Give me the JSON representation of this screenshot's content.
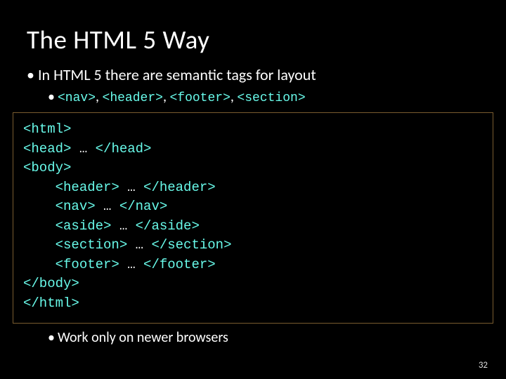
{
  "title": "The HTML 5 Way",
  "bullet1": "In HTML 5 there are semantic tags for layout",
  "tags_line": {
    "t1": "<nav>",
    "t2": "<header>",
    "t3": "<footer>",
    "t4": "<section>"
  },
  "code": {
    "l1": "<html>",
    "l2a": "<head>",
    "l2b": " … ",
    "l2c": "</head>",
    "l3": "<body>",
    "l4a": "    <header>",
    "l4b": " … ",
    "l4c": "</header>",
    "l5a": "    <nav>",
    "l5b": " … ",
    "l5c": "</nav>",
    "l6a": "    <aside>",
    "l6b": " … ",
    "l6c": "</aside>",
    "l7a": "    <section>",
    "l7b": " … ",
    "l7c": "</section>",
    "l8a": "    <footer>",
    "l8b": " … ",
    "l8c": "</footer>",
    "l9": "</body>",
    "l10": "</html>"
  },
  "bullet2": "Work only on newer browsers",
  "page_number": "32"
}
